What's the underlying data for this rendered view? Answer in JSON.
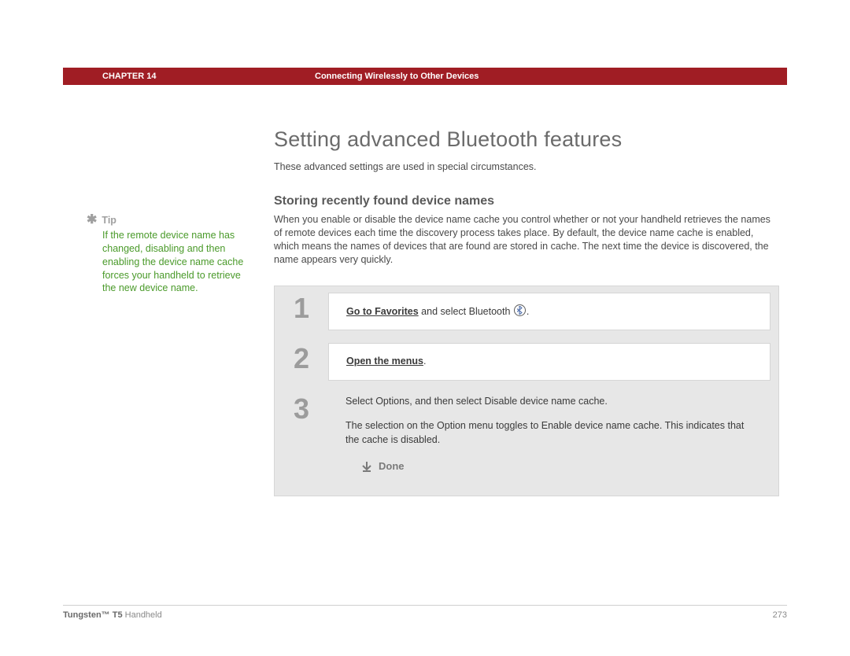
{
  "header": {
    "chapter_label": "CHAPTER 14",
    "topic": "Connecting Wirelessly to Other Devices"
  },
  "sidebar": {
    "tip_label": "Tip",
    "tip_body": "If the remote device name has changed, disabling and then enabling the device name cache forces your handheld to retrieve the new device name."
  },
  "main": {
    "title": "Setting advanced Bluetooth features",
    "intro": "These advanced settings are used in special circumstances.",
    "section_title": "Storing recently found device names",
    "section_body": "When you enable or disable the device name cache you control whether or not your handheld retrieves the names of remote devices each time the discovery process takes place. By default, the device name cache is enabled, which means the names of devices that are found are stored in cache. The next time the device is discovered, the name appears very quickly.",
    "steps": {
      "s1": {
        "n": "1",
        "link": "Go to Favorites",
        "rest": " and select Bluetooth ",
        "tail": "."
      },
      "s2": {
        "n": "2",
        "link": "Open the menus",
        "tail": "."
      },
      "s3": {
        "n": "3",
        "p1": "Select Options, and then select Disable device name cache.",
        "p2": "The selection on the Option menu toggles to Enable device name cache. This indicates that the cache is disabled."
      }
    },
    "done_label": "Done"
  },
  "footer": {
    "product_bold": "Tungsten™ T5",
    "product_rest": " Handheld",
    "page_number": "273"
  }
}
